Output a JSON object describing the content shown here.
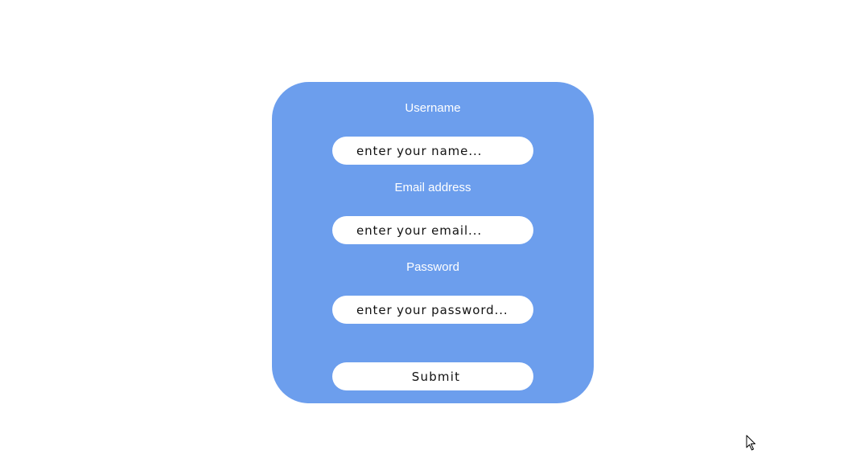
{
  "form": {
    "username_label": "Username",
    "username_placeholder": "enter your name...",
    "email_label": "Email address",
    "email_placeholder": "enter your email...",
    "password_label": "Password",
    "password_placeholder": "enter your password...",
    "submit_label": "Submit"
  },
  "colors": {
    "card_background": "#6c9eed",
    "field_background": "#ffffff",
    "label_text": "#ffffff"
  },
  "icons": {
    "cursor": "mouse-pointer-icon"
  }
}
